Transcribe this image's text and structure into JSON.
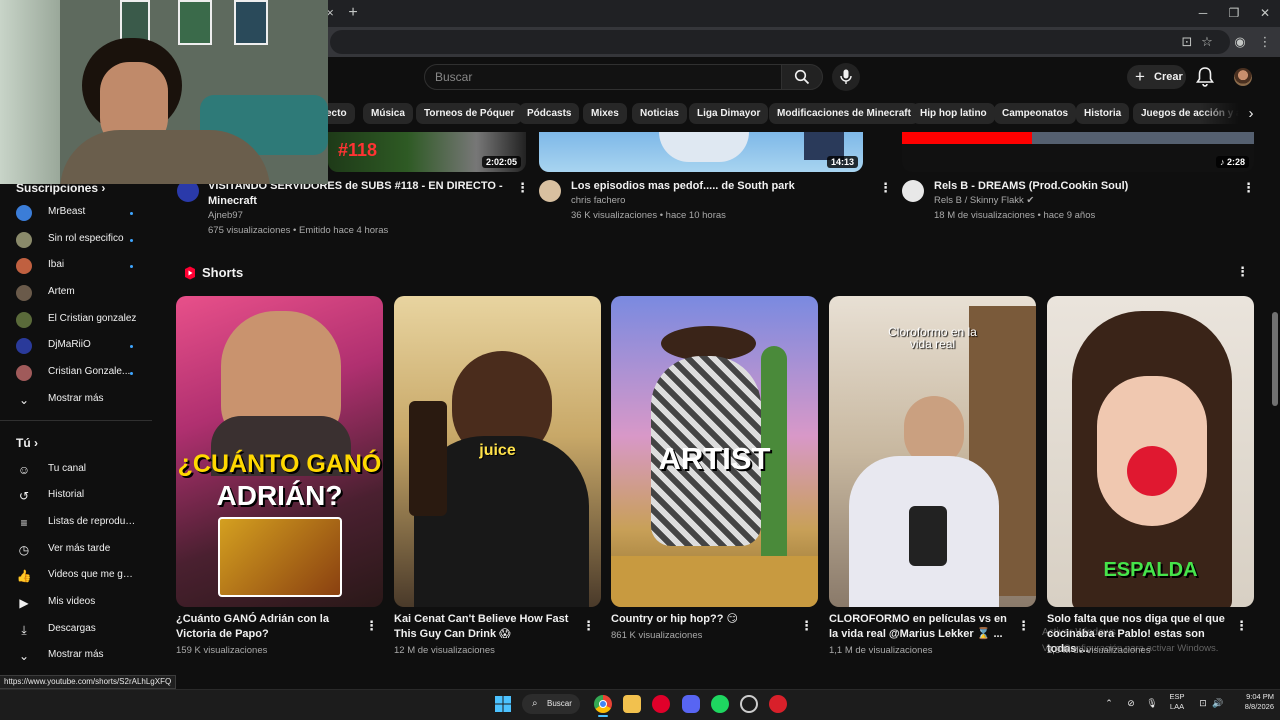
{
  "browser": {
    "tab_close": "×",
    "new_tab": "+"
  },
  "masthead": {
    "search_placeholder": "Buscar",
    "create_label": "Crear"
  },
  "chips": [
    "ecto",
    "Música",
    "Torneos de Póquer",
    "Pódcasts",
    "Mixes",
    "Noticias",
    "Liga Dimayor",
    "Modificaciones de Minecraft",
    "Hip hop latino",
    "Campeonatos",
    "Historia",
    "Juegos de acción y aven"
  ],
  "videos": [
    {
      "title": "VISITANDO SERVIDORES de SUBS #118 - EN DIRECTO - Minecraft",
      "channel": "Ajneb97",
      "meta": "675 visualizaciones • Emitido hace 4 horas",
      "duration": "2:02:05",
      "thumb_text": "#118"
    },
    {
      "title": "Los episodios mas pedof..... de South park",
      "channel": "chris fachero",
      "meta": "36 K visualizaciones • hace 10 horas",
      "duration": "14:13"
    },
    {
      "title": "Rels B - DREAMS (Prod.Cookin Soul)",
      "channel": "Rels B / Skinny Flakk",
      "meta": "18 M de visualizaciones • hace 9 años",
      "duration": "2:28"
    }
  ],
  "sidebar": {
    "subs_header": "Suscripciones",
    "subscriptions": [
      {
        "name": "MrBeast",
        "dot": true,
        "color": "#3b7dd8"
      },
      {
        "name": "Sin rol especifico",
        "dot": true,
        "color": "#8a8a6a"
      },
      {
        "name": "Ibai",
        "dot": true,
        "color": "#c06040"
      },
      {
        "name": "Artem",
        "dot": false,
        "color": "#6a5a4a"
      },
      {
        "name": "El Cristian gonzalez",
        "dot": false,
        "color": "#5a6a3a"
      },
      {
        "name": "DjMaRiiO",
        "dot": true,
        "color": "#2a3a9a"
      },
      {
        "name": "Cristian Gonzale...",
        "dot": true,
        "color": "#a05a5a"
      }
    ],
    "show_more_1": "Mostrar más",
    "you_header": "Tú",
    "you_items": [
      "Tu canal",
      "Historial",
      "Listas de reproducc...",
      "Ver más tarde",
      "Videos que me gus...",
      "Mis videos",
      "Descargas",
      "Mostrar más"
    ]
  },
  "shorts": {
    "section_title": "Shorts",
    "items": [
      {
        "title": "¿Cuánto GANÓ Adrián con la Victoria de Papo?",
        "views": "159 K visualizaciones",
        "overlay_1": "¿CUÁNTO GANÓ",
        "overlay_2": "ADRIÁN?"
      },
      {
        "title": "Kai Cenat Can't Believe How Fast This Guy Can Drink 😱",
        "views": "12 M de visualizaciones",
        "overlay_1": "juice"
      },
      {
        "title": "Country or hip hop?? 😏",
        "views": "861 K visualizaciones",
        "overlay_1": "ARTIST"
      },
      {
        "title": "CLOROFORMO en películas vs en la vida real @Marius Lekker ⌛ ...",
        "views": "1,1 M de visualizaciones",
        "overlay_1": "Cloroformo en la",
        "overlay_2": "vida real"
      },
      {
        "title": "Solo falta que nos diga que el que cocinaba era Pablo! estas son todas ...",
        "views": "2,8 M de visualizaciones",
        "overlay_1": "ESPALDA"
      }
    ]
  },
  "status_url": "https://www.youtube.com/shorts/S2rALhLgXFQ",
  "watermark": {
    "line1": "Activar Windows",
    "line2": "Ve a Configuración para activar Windows."
  },
  "taskbar": {
    "search_label": "Buscar",
    "lang_1": "ESP",
    "lang_2": "LAA",
    "time": "9:04 PM",
    "date": "8/8/2026"
  }
}
